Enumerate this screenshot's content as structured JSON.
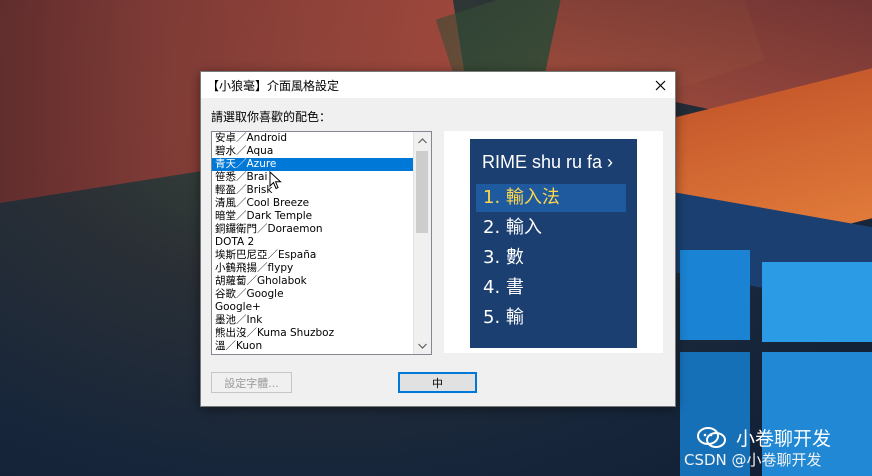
{
  "dialog": {
    "title": "【小狼毫】介面風格設定",
    "prompt": "請選取你喜歡的配色：",
    "schemes": [
      {
        "label": "安卓／Android",
        "selected": false
      },
      {
        "label": "碧水／Aqua",
        "selected": false
      },
      {
        "label": "青天／Azure",
        "selected": true
      },
      {
        "label": "笹悉／Brai",
        "selected": false
      },
      {
        "label": "輕盈／Brisk",
        "selected": false
      },
      {
        "label": "清風／Cool Breeze",
        "selected": false
      },
      {
        "label": "暗堂／Dark Temple",
        "selected": false
      },
      {
        "label": "銅鑼衛門／Doraemon",
        "selected": false
      },
      {
        "label": "DOTA 2",
        "selected": false
      },
      {
        "label": "埃斯巴尼亞／España",
        "selected": false
      },
      {
        "label": "小鶴飛揚／flypy",
        "selected": false
      },
      {
        "label": "胡蘿蔔／Gholabok",
        "selected": false
      },
      {
        "label": "谷歌／Google",
        "selected": false
      },
      {
        "label": "Google+",
        "selected": false
      },
      {
        "label": "墨池／Ink",
        "selected": false
      },
      {
        "label": "熊出沒／Kuma Shuzboz",
        "selected": false
      },
      {
        "label": "溫／Kuon",
        "selected": false
      }
    ],
    "preview": {
      "header": "RIME shu ru fa ›",
      "candidates": [
        "1. 輸入法",
        "2. 輸入",
        "3. 數",
        "4. 書",
        "5. 輸"
      ],
      "highlighted_index": 0
    },
    "buttons": {
      "font": "設定字體...",
      "ok": "中"
    }
  },
  "watermark": {
    "name": "小卷聊开发",
    "csdn": "CSDN @小卷聊开发"
  },
  "colors": {
    "selection": "#0078d7",
    "preview_bg": "#1a3f70",
    "preview_highlight": "#1f5a9e",
    "preview_highlight_text": "#ffd84a"
  }
}
